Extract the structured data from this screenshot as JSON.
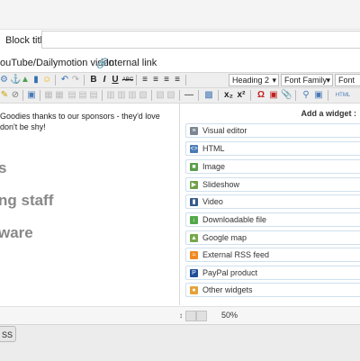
{
  "block": {
    "title_label": "Block title",
    "title_value": ""
  },
  "links": {
    "video": "ouTube/Dailymotion video",
    "internal": "Internal link",
    "internal_icon": "link-icon"
  },
  "toolbar": {
    "bold": "B",
    "italic": "I",
    "underline": "U",
    "strike": "ABC",
    "heading": "Heading 2",
    "font_family": "Font Family",
    "font_size": "Font Size",
    "sub": "x₂",
    "sup": "x²",
    "omega": "Ω",
    "html": "HTML"
  },
  "editor": {
    "paragraph": "Goodies thanks to our sponsors - they'd love don't be shy!",
    "h1": "s",
    "h2": "ng staff",
    "h3": "ware"
  },
  "widgets": {
    "title": "Add a widget :",
    "items": [
      {
        "label": "Visual editor",
        "icon": "visual-editor-icon",
        "color": "#7a8793"
      },
      {
        "label": "HTML",
        "icon": "html-icon",
        "color": "#4a7bb7"
      },
      {
        "label": "Image",
        "icon": "image-icon",
        "color": "#5a9e4a"
      },
      {
        "label": "Slideshow",
        "icon": "slideshow-icon",
        "color": "#6fa04a"
      },
      {
        "label": "Video",
        "icon": "video-icon",
        "color": "#355a8a"
      },
      {
        "label": "Downloadable file",
        "icon": "download-icon",
        "color": "#52a84a"
      },
      {
        "label": "Google map",
        "icon": "map-icon",
        "color": "#74a84a"
      },
      {
        "label": "External RSS feed",
        "icon": "rss-icon",
        "color": "#f08a22"
      },
      {
        "label": "PayPal product",
        "icon": "paypal-icon",
        "color": "#1f4f9a"
      },
      {
        "label": "Other widgets",
        "icon": "widgets-icon",
        "color": "#e6a23a"
      }
    ]
  },
  "status": {
    "zoom": "50%"
  },
  "bottom": {
    "button_label": "SS"
  }
}
